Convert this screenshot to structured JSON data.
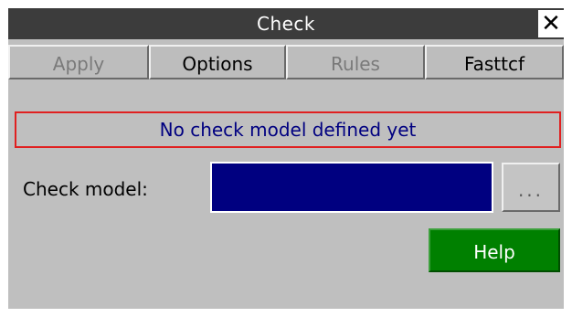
{
  "window": {
    "title": "Check",
    "close_glyph": "✕"
  },
  "tabs": [
    {
      "label": "Apply",
      "enabled": false
    },
    {
      "label": "Options",
      "enabled": true
    },
    {
      "label": "Rules",
      "enabled": false
    },
    {
      "label": "Fasttcf",
      "enabled": true
    }
  ],
  "message": {
    "text": "No check model defined yet",
    "border_color": "#e02020",
    "text_color": "#000080"
  },
  "check_model": {
    "label": "Check model:",
    "value": "",
    "field_color": "#000080",
    "browse_label": "..."
  },
  "help": {
    "label": "Help",
    "color": "#008000"
  }
}
